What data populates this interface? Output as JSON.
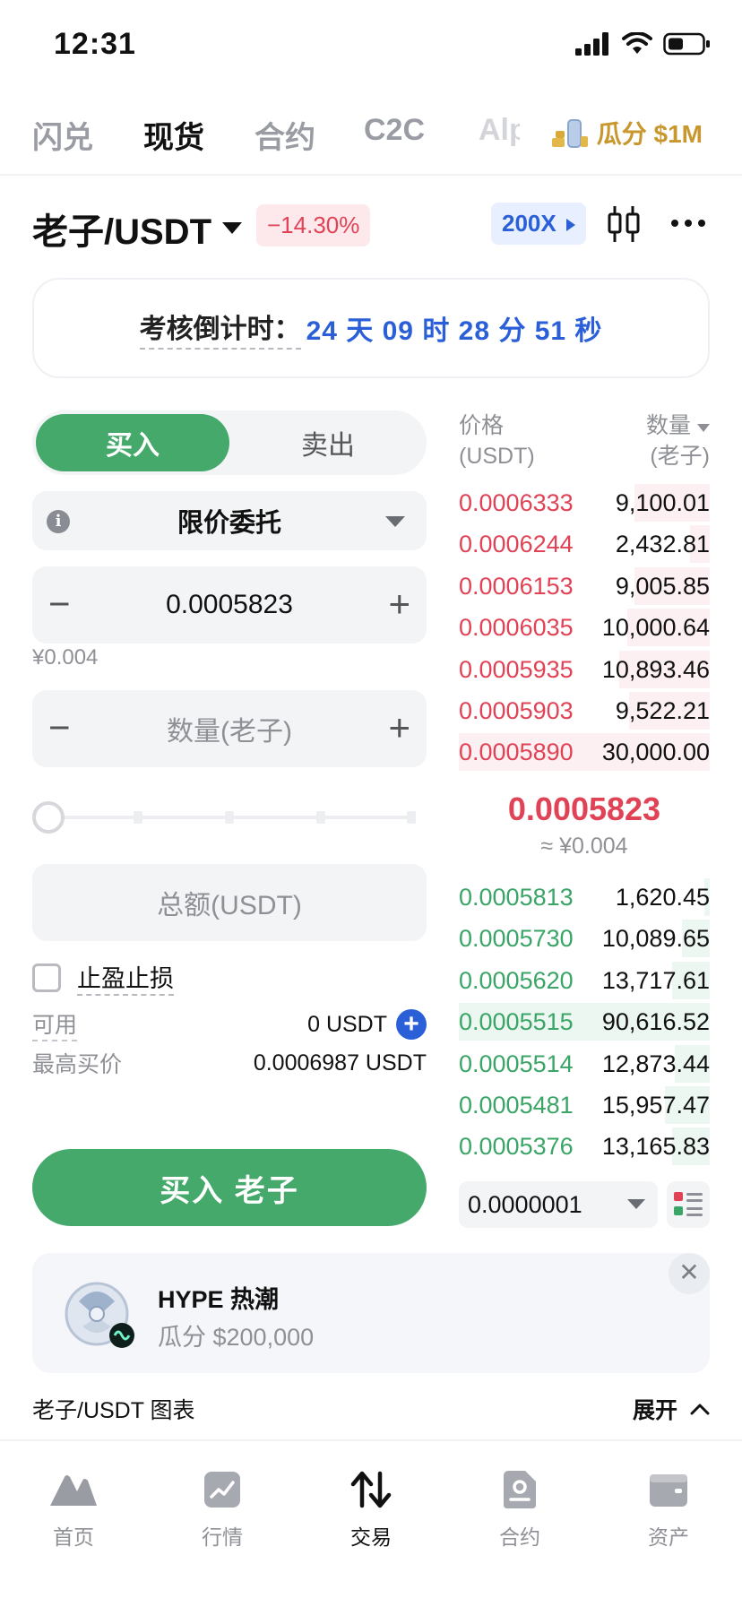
{
  "status_bar": {
    "time": "12:31"
  },
  "top_tabs": [
    {
      "label": "闪兑"
    },
    {
      "label": "现货"
    },
    {
      "label": "合约"
    },
    {
      "label": "C2C"
    },
    {
      "label": "Alp"
    }
  ],
  "promo": {
    "label": "瓜分 $1M"
  },
  "pair_header": {
    "pair": "老子/USDT",
    "change": "−14.30%",
    "leverage": "200X"
  },
  "countdown": {
    "label": "考核倒计时：",
    "value": "24 天 09 时 28 分 51 秒"
  },
  "order_form": {
    "buy_tab": "买入",
    "sell_tab": "卖出",
    "order_type": "限价委托",
    "price_value": "0.0005823",
    "price_cny": "¥0.004",
    "quantity_placeholder": "数量(老子)",
    "total_placeholder": "总额(USDT)",
    "tpsl_label": "止盈止损",
    "available_label": "可用",
    "available_value": "0 USDT",
    "max_buy_label": "最高买价",
    "max_buy_value": "0.0006987 USDT",
    "submit_label": "买入  老子"
  },
  "order_book": {
    "price_header": "价格",
    "price_unit": "(USDT)",
    "qty_header": "数量",
    "qty_unit": "(老子)",
    "asks": [
      {
        "price": "0.0006333",
        "qty": "9,100.01",
        "depth": 0.3
      },
      {
        "price": "0.0006244",
        "qty": "2,432.81",
        "depth": 0.08
      },
      {
        "price": "0.0006153",
        "qty": "9,005.85",
        "depth": 0.3
      },
      {
        "price": "0.0006035",
        "qty": "10,000.64",
        "depth": 0.33
      },
      {
        "price": "0.0005935",
        "qty": "10,893.46",
        "depth": 0.36
      },
      {
        "price": "0.0005903",
        "qty": "9,522.21",
        "depth": 0.32
      },
      {
        "price": "0.0005890",
        "qty": "30,000.00",
        "depth": 1.0
      }
    ],
    "last_price": "0.0005823",
    "last_price_cny": "≈ ¥0.004",
    "bids": [
      {
        "price": "0.0005813",
        "qty": "1,620.45",
        "depth": 0.02
      },
      {
        "price": "0.0005730",
        "qty": "10,089.65",
        "depth": 0.11
      },
      {
        "price": "0.0005620",
        "qty": "13,717.61",
        "depth": 0.15
      },
      {
        "price": "0.0005515",
        "qty": "90,616.52",
        "depth": 1.0
      },
      {
        "price": "0.0005514",
        "qty": "12,873.44",
        "depth": 0.14
      },
      {
        "price": "0.0005481",
        "qty": "15,957.47",
        "depth": 0.18
      },
      {
        "price": "0.0005376",
        "qty": "13,165.83",
        "depth": 0.15
      }
    ],
    "precision": "0.0000001"
  },
  "banner": {
    "title": "HYPE 热潮",
    "subtitle": "瓜分 $200,000"
  },
  "chart_section": {
    "label": "老子/USDT 图表",
    "expand_label": "展开"
  },
  "bottom_nav": [
    {
      "label": "首页",
      "icon": "home-icon"
    },
    {
      "label": "行情",
      "icon": "market-icon"
    },
    {
      "label": "交易",
      "icon": "trade-icon"
    },
    {
      "label": "合约",
      "icon": "futures-icon"
    },
    {
      "label": "资产",
      "icon": "wallet-icon"
    }
  ],
  "colors": {
    "buy_green": "#44a96a",
    "ask_red": "#e04355",
    "link_blue": "#2a5fd8",
    "promo_gold": "#c8982f"
  }
}
